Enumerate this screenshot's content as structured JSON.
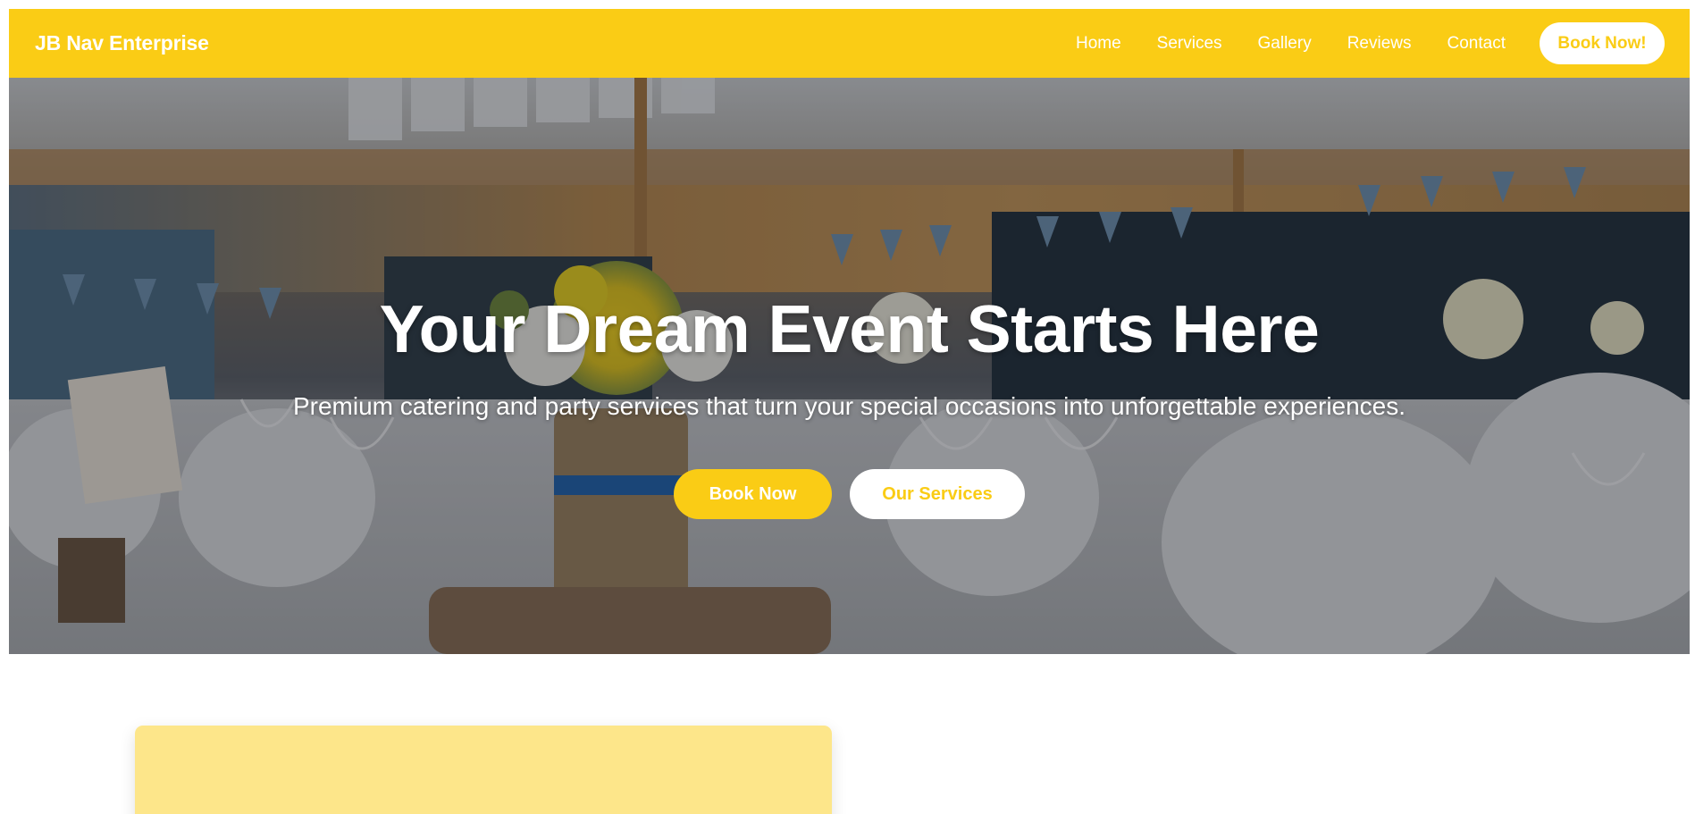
{
  "header": {
    "brand": "JB Nav Enterprise",
    "nav_items": [
      {
        "label": "Home"
      },
      {
        "label": "Services"
      },
      {
        "label": "Gallery"
      },
      {
        "label": "Reviews"
      },
      {
        "label": "Contact"
      }
    ],
    "cta_label": "Book Now!"
  },
  "hero": {
    "title": "Your Dream Event Starts Here",
    "subtitle": "Premium catering and party services that turn your special occasions into unforgettable experiences.",
    "primary_button": "Book Now",
    "secondary_button": "Our Services"
  },
  "colors": {
    "brand_yellow": "#facc15",
    "card_yellow": "#fde68a",
    "white": "#ffffff"
  }
}
